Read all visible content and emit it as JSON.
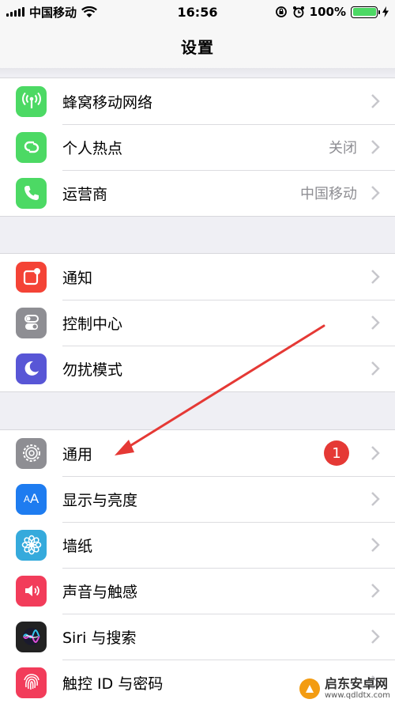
{
  "status_bar": {
    "carrier": "中国移动",
    "time": "16:56",
    "battery_percent": "100%",
    "battery_level": 1.0
  },
  "nav": {
    "title": "设置"
  },
  "groups": [
    {
      "rows": [
        {
          "label": "蜂窝移动网络",
          "detail": "",
          "icon": "antenna-icon",
          "color": "#4cd964"
        },
        {
          "label": "个人热点",
          "detail": "关闭",
          "icon": "hotspot-icon",
          "color": "#4cd964"
        },
        {
          "label": "运营商",
          "detail": "中国移动",
          "icon": "phone-icon",
          "color": "#4cd964"
        }
      ]
    },
    {
      "rows": [
        {
          "label": "通知",
          "detail": "",
          "icon": "notification-icon",
          "color": "#f44336"
        },
        {
          "label": "控制中心",
          "detail": "",
          "icon": "toggles-icon",
          "color": "#8e8e93"
        },
        {
          "label": "勿扰模式",
          "detail": "",
          "icon": "moon-icon",
          "color": "#5856d6"
        }
      ]
    },
    {
      "rows": [
        {
          "label": "通用",
          "detail": "",
          "badge": "1",
          "icon": "gear-icon",
          "color": "#8e8e93"
        },
        {
          "label": "显示与亮度",
          "detail": "",
          "icon": "text-size-icon",
          "color": "#1e7cf0"
        },
        {
          "label": "墙纸",
          "detail": "",
          "icon": "flower-icon",
          "color": "#35aadc"
        },
        {
          "label": "声音与触感",
          "detail": "",
          "icon": "speaker-icon",
          "color": "#f23c5a"
        },
        {
          "label": "Siri 与搜索",
          "detail": "",
          "icon": "siri-icon",
          "color": "#222222"
        },
        {
          "label": "触控 ID 与密码",
          "detail": "",
          "icon": "fingerprint-icon",
          "color": "#f23c5a"
        }
      ]
    }
  ],
  "watermark": {
    "name": "启东安卓网",
    "url": "www.qdldtx.com"
  }
}
